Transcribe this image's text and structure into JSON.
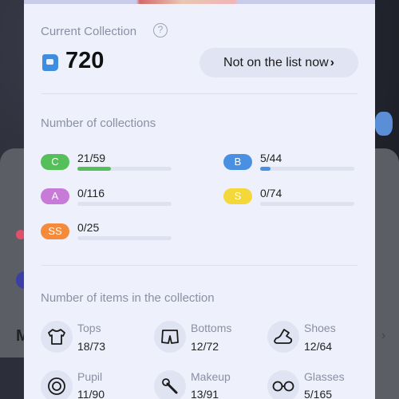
{
  "current": {
    "label": "Current Collection",
    "count": "720",
    "list_button": "Not on the list now",
    "list_button_chevron": "›"
  },
  "collections": {
    "label": "Number of collections",
    "ranks": [
      {
        "grade": "C",
        "value": "21/59",
        "progress": 0.356,
        "color": "#55c05a"
      },
      {
        "grade": "B",
        "value": "5/44",
        "progress": 0.114,
        "color": "#4a90e2"
      },
      {
        "grade": "A",
        "value": "0/116",
        "progress": 0,
        "color": "#c77ad8"
      },
      {
        "grade": "S",
        "value": "0/74",
        "progress": 0,
        "color": "#f4d83a"
      },
      {
        "grade": "SS",
        "value": "0/25",
        "progress": 0,
        "color": "#f48a3a"
      }
    ]
  },
  "items": {
    "label": "Number of  items in the collection",
    "list": [
      {
        "name": "Tops",
        "value": "18/73",
        "icon": "shirt-icon"
      },
      {
        "name": "Bottoms",
        "value": "12/72",
        "icon": "shorts-icon"
      },
      {
        "name": "Shoes",
        "value": "12/64",
        "icon": "shoe-icon"
      },
      {
        "name": "Pupil",
        "value": "11/90",
        "icon": "eye-icon"
      },
      {
        "name": "Makeup",
        "value": "13/91",
        "icon": "brush-icon"
      },
      {
        "name": "Glasses",
        "value": "5/165",
        "icon": "glasses-icon"
      }
    ]
  },
  "background": {
    "letter": "M",
    "chevron": "›"
  }
}
